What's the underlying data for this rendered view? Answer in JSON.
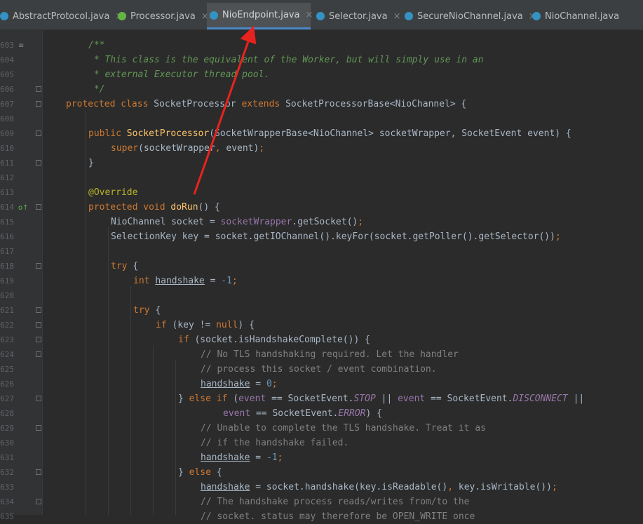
{
  "tabs": [
    {
      "label": "AbstractProtocol.java",
      "icon": "class-icon",
      "active": false
    },
    {
      "label": "Processor.java",
      "icon": "interface-icon",
      "active": false
    },
    {
      "label": "NioEndpoint.java",
      "icon": "class-icon",
      "active": true
    },
    {
      "label": "Selector.java",
      "icon": "class-icon",
      "active": false
    },
    {
      "label": "SecureNioChannel.java",
      "icon": "class-icon",
      "active": false
    },
    {
      "label": "NioChannel.java",
      "icon": "class-icon",
      "active": false
    }
  ],
  "close_glyph": "×",
  "colors": {
    "accent": "#4a88c7",
    "annotation_arrow": "#e8231f"
  },
  "code_lines": [
    {
      "n": "603",
      "indent": 1,
      "fold": false,
      "marker": "≡",
      "tokens": [
        {
          "t": "/**",
          "c": "doc"
        }
      ]
    },
    {
      "n": "604",
      "indent": 1,
      "fold": false,
      "tokens": [
        {
          "t": " * This class is the equivalent of the Worker, but will simply use in an",
          "c": "doc"
        }
      ]
    },
    {
      "n": "605",
      "indent": 1,
      "fold": false,
      "tokens": [
        {
          "t": " * external Executor thread pool.",
          "c": "doc"
        }
      ]
    },
    {
      "n": "606",
      "indent": 1,
      "fold": true,
      "tokens": [
        {
          "t": " */",
          "c": "doc"
        }
      ]
    },
    {
      "n": "607",
      "indent": 0,
      "fold": true,
      "tokens": [
        {
          "t": "protected class ",
          "c": "kw"
        },
        {
          "t": "SocketProcessor ",
          "c": "pl"
        },
        {
          "t": "extends ",
          "c": "kw"
        },
        {
          "t": "SocketProcessorBase<NioChannel> {",
          "c": "pl"
        }
      ]
    },
    {
      "n": "608",
      "indent": 0,
      "fold": false,
      "tokens": []
    },
    {
      "n": "609",
      "indent": 1,
      "fold": true,
      "tokens": [
        {
          "t": "public ",
          "c": "kw"
        },
        {
          "t": "SocketProcessor",
          "c": "fn"
        },
        {
          "t": "(SocketWrapperBase<NioChannel> socketWrapper, SocketEvent event) {",
          "c": "pl"
        }
      ]
    },
    {
      "n": "610",
      "indent": 2,
      "fold": false,
      "tokens": [
        {
          "t": "super",
          "c": "kw"
        },
        {
          "t": "(socketWrapper",
          "c": "pl"
        },
        {
          "t": ", ",
          "c": "kw"
        },
        {
          "t": "event)",
          "c": "pl"
        },
        {
          "t": ";",
          "c": "kw"
        }
      ]
    },
    {
      "n": "611",
      "indent": 1,
      "fold": true,
      "tokens": [
        {
          "t": "}",
          "c": "pl"
        }
      ]
    },
    {
      "n": "612",
      "indent": 0,
      "fold": false,
      "tokens": []
    },
    {
      "n": "613",
      "indent": 1,
      "fold": false,
      "tokens": [
        {
          "t": "@Override",
          "c": "ann"
        }
      ]
    },
    {
      "n": "614",
      "indent": 1,
      "fold": true,
      "marker": "o↑",
      "tokens": [
        {
          "t": "protected void ",
          "c": "kw"
        },
        {
          "t": "doRun",
          "c": "fn"
        },
        {
          "t": "() {",
          "c": "pl"
        }
      ]
    },
    {
      "n": "615",
      "indent": 2,
      "fold": false,
      "tokens": [
        {
          "t": "NioChannel socket = ",
          "c": "pl"
        },
        {
          "t": "socketWrapper",
          "c": "field"
        },
        {
          "t": ".getSocket()",
          "c": "pl"
        },
        {
          "t": ";",
          "c": "kw"
        }
      ]
    },
    {
      "n": "616",
      "indent": 2,
      "fold": false,
      "tokens": [
        {
          "t": "SelectionKey key = socket.getIOChannel().keyFor(socket.getPoller().getSelector())",
          "c": "pl"
        },
        {
          "t": ";",
          "c": "kw"
        }
      ]
    },
    {
      "n": "617",
      "indent": 0,
      "fold": false,
      "tokens": []
    },
    {
      "n": "618",
      "indent": 2,
      "fold": true,
      "tokens": [
        {
          "t": "try ",
          "c": "kw"
        },
        {
          "t": "{",
          "c": "pl"
        }
      ]
    },
    {
      "n": "619",
      "indent": 3,
      "fold": false,
      "tokens": [
        {
          "t": "int ",
          "c": "kw"
        },
        {
          "t": "handshake",
          "c": "u"
        },
        {
          "t": " = ",
          "c": "pl"
        },
        {
          "t": "-1",
          "c": "num"
        },
        {
          "t": ";",
          "c": "kw"
        }
      ]
    },
    {
      "n": "620",
      "indent": 0,
      "fold": false,
      "tokens": []
    },
    {
      "n": "621",
      "indent": 3,
      "fold": true,
      "tokens": [
        {
          "t": "try ",
          "c": "kw"
        },
        {
          "t": "{",
          "c": "pl"
        }
      ]
    },
    {
      "n": "622",
      "indent": 4,
      "fold": true,
      "tokens": [
        {
          "t": "if ",
          "c": "kw"
        },
        {
          "t": "(key != ",
          "c": "pl"
        },
        {
          "t": "null",
          "c": "kw"
        },
        {
          "t": ") {",
          "c": "pl"
        }
      ]
    },
    {
      "n": "623",
      "indent": 5,
      "fold": true,
      "tokens": [
        {
          "t": "if ",
          "c": "kw"
        },
        {
          "t": "(socket.isHandshakeComplete()) {",
          "c": "pl"
        }
      ]
    },
    {
      "n": "624",
      "indent": 6,
      "fold": true,
      "tokens": [
        {
          "t": "// No TLS handshaking required. Let the handler",
          "c": "cmt"
        }
      ]
    },
    {
      "n": "625",
      "indent": 6,
      "fold": false,
      "tokens": [
        {
          "t": "// process this socket / event combination.",
          "c": "cmt"
        }
      ]
    },
    {
      "n": "626",
      "indent": 6,
      "fold": false,
      "tokens": [
        {
          "t": "handshake",
          "c": "u"
        },
        {
          "t": " = ",
          "c": "pl"
        },
        {
          "t": "0",
          "c": "num"
        },
        {
          "t": ";",
          "c": "kw"
        }
      ]
    },
    {
      "n": "627",
      "indent": 5,
      "fold": true,
      "tokens": [
        {
          "t": "} ",
          "c": "pl"
        },
        {
          "t": "else if ",
          "c": "kw"
        },
        {
          "t": "(",
          "c": "pl"
        },
        {
          "t": "event",
          "c": "field"
        },
        {
          "t": " == SocketEvent.",
          "c": "pl"
        },
        {
          "t": "STOP",
          "c": "sfield"
        },
        {
          "t": " || ",
          "c": "pl"
        },
        {
          "t": "event",
          "c": "field"
        },
        {
          "t": " == SocketEvent.",
          "c": "pl"
        },
        {
          "t": "DISCONNECT",
          "c": "sfield"
        },
        {
          "t": " ||",
          "c": "pl"
        }
      ]
    },
    {
      "n": "628",
      "indent": 7,
      "fold": false,
      "tokens": [
        {
          "t": "event",
          "c": "field"
        },
        {
          "t": " == SocketEvent.",
          "c": "pl"
        },
        {
          "t": "ERROR",
          "c": "sfield"
        },
        {
          "t": ") {",
          "c": "pl"
        }
      ]
    },
    {
      "n": "629",
      "indent": 6,
      "fold": true,
      "tokens": [
        {
          "t": "// Unable to complete the TLS handshake. Treat it as",
          "c": "cmt"
        }
      ]
    },
    {
      "n": "630",
      "indent": 6,
      "fold": false,
      "tokens": [
        {
          "t": "// if the handshake failed.",
          "c": "cmt"
        }
      ]
    },
    {
      "n": "631",
      "indent": 6,
      "fold": false,
      "tokens": [
        {
          "t": "handshake",
          "c": "u"
        },
        {
          "t": " = ",
          "c": "pl"
        },
        {
          "t": "-1",
          "c": "num"
        },
        {
          "t": ";",
          "c": "kw"
        }
      ]
    },
    {
      "n": "632",
      "indent": 5,
      "fold": true,
      "tokens": [
        {
          "t": "} ",
          "c": "pl"
        },
        {
          "t": "else ",
          "c": "kw"
        },
        {
          "t": "{",
          "c": "pl"
        }
      ]
    },
    {
      "n": "633",
      "indent": 6,
      "fold": false,
      "tokens": [
        {
          "t": "handshake",
          "c": "u"
        },
        {
          "t": " = socket.handshake(key.isReadable()",
          "c": "pl"
        },
        {
          "t": ", ",
          "c": "kw"
        },
        {
          "t": "key.isWritable())",
          "c": "pl"
        },
        {
          "t": ";",
          "c": "kw"
        }
      ]
    },
    {
      "n": "634",
      "indent": 6,
      "fold": true,
      "tokens": [
        {
          "t": "// The handshake process reads/writes from/to the",
          "c": "cmt"
        }
      ]
    },
    {
      "n": "635",
      "indent": 6,
      "fold": false,
      "tokens": [
        {
          "t": "// socket. status may therefore be OPEN_WRITE once",
          "c": "cmt"
        }
      ]
    }
  ]
}
